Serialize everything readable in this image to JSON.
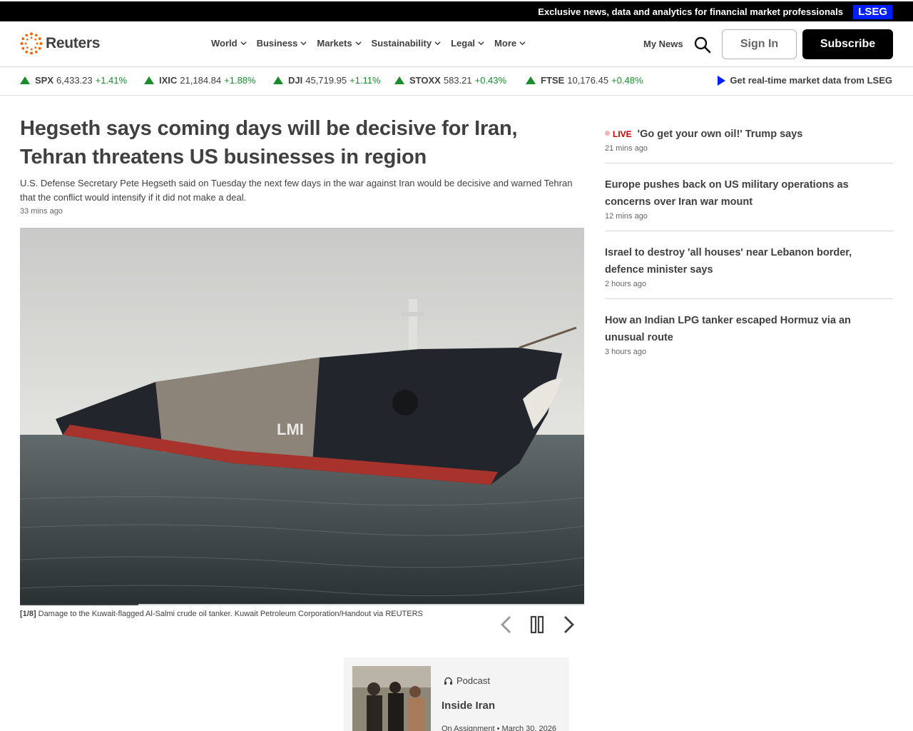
{
  "topbar": {
    "promo": "Exclusive news, data and analytics for financial market professionals",
    "badge": "LSEG"
  },
  "header": {
    "logo_text": "Reuters",
    "nav": [
      "World",
      "Business",
      "Markets",
      "Sustainability",
      "Legal",
      "More"
    ],
    "my_news": "My News",
    "sign_in": "Sign In",
    "subscribe": "Subscribe"
  },
  "ticker": {
    "items": [
      {
        "symbol": "SPX",
        "value": "6,433.23",
        "change": "+1.41%"
      },
      {
        "symbol": "IXIC",
        "value": "21,184.84",
        "change": "+1.88%"
      },
      {
        "symbol": "DJI",
        "value": "45,719.95",
        "change": "+1.11%"
      },
      {
        "symbol": "STOXX",
        "value": "583.21",
        "change": "+0.43%"
      },
      {
        "symbol": "FTSE",
        "value": "10,176.45",
        "change": "+0.48%"
      }
    ],
    "lseg_link": "Get real-time market data from LSEG",
    "up_color": "#1a8c2e"
  },
  "article": {
    "headline": "Hegseth says coming days will be decisive for Iran, Tehran threatens US businesses in region",
    "summary": "U.S. Defense Secretary Pete Hegseth said on Tuesday the next few days in the war against Iran would be decisive and warned Tehran that the conflict would intensify if it did not make a deal.",
    "time": "33 mins ago"
  },
  "gallery": {
    "index": "[1/8]",
    "caption": "Damage to the Kuwait-flagged Al-Salmi crude oil tanker. Kuwait Petroleum Corporation/Handout via REUTERS",
    "progress_fraction": 0.21,
    "hull_text": "LMI"
  },
  "sidebar": {
    "live_label": "LIVE",
    "stories": [
      {
        "title": "'Go get your own oil!' Trump says",
        "time": "21 mins ago",
        "live": true
      },
      {
        "title": "Europe pushes back on US military operations as concerns over Iran war mount",
        "time": "12 mins ago",
        "live": false
      },
      {
        "title": "Israel to destroy 'all houses' near Lebanon border, defence minister says",
        "time": "2 hours ago",
        "live": false
      },
      {
        "title": "How an Indian LPG tanker escaped Hormuz via an unusual route",
        "time": "3 hours ago",
        "live": false
      }
    ]
  },
  "podcast": {
    "kicker": "Podcast",
    "title": "Inside Iran",
    "meta": "On Assignment • March 30, 2026"
  },
  "colors": {
    "lseg_blue": "#001eff",
    "live_red": "#cc0000",
    "text": "#404040"
  }
}
